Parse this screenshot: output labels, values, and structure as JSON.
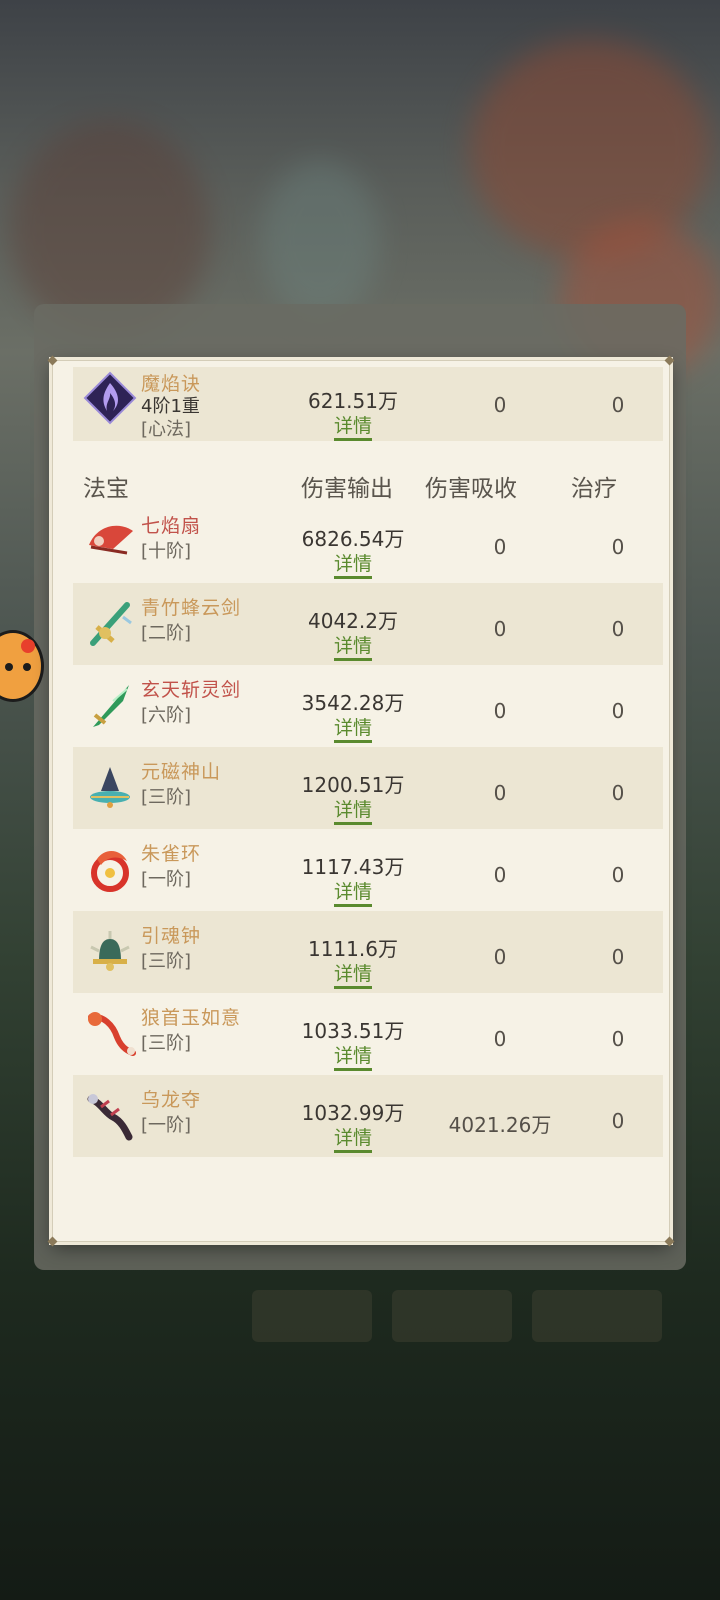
{
  "top_skill": {
    "name": "魔焰诀",
    "level": "4阶1重",
    "type": "[心法]",
    "damage": "621.51万",
    "detail": "详情",
    "absorb": "0",
    "heal": "0",
    "icon": "purple-flame-diamond-icon"
  },
  "header": {
    "col_item": "法宝",
    "col_damage": "伤害输出",
    "col_absorb": "伤害吸收",
    "col_heal": "治疗"
  },
  "items": [
    {
      "name": "七焰扇",
      "rank": "[十阶]",
      "damage": "6826.54万",
      "detail": "详情",
      "absorb": "0",
      "heal": "0",
      "color": "#c1524a",
      "icon": "fan-icon"
    },
    {
      "name": "青竹蜂云剑",
      "rank": "[二阶]",
      "damage": "4042.2万",
      "detail": "详情",
      "absorb": "0",
      "heal": "0",
      "color": "#c9985a",
      "icon": "bamboo-sword-icon"
    },
    {
      "name": "玄天斩灵剑",
      "rank": "[六阶]",
      "damage": "3542.28万",
      "detail": "详情",
      "absorb": "0",
      "heal": "0",
      "color": "#c1524a",
      "icon": "jade-sword-icon"
    },
    {
      "name": "元磁神山",
      "rank": "[三阶]",
      "damage": "1200.51万",
      "detail": "详情",
      "absorb": "0",
      "heal": "0",
      "color": "#c9985a",
      "icon": "mountain-icon"
    },
    {
      "name": "朱雀环",
      "rank": "[一阶]",
      "damage": "1117.43万",
      "detail": "详情",
      "absorb": "0",
      "heal": "0",
      "color": "#c9985a",
      "icon": "phoenix-ring-icon"
    },
    {
      "name": "引魂钟",
      "rank": "[三阶]",
      "damage": "1111.6万",
      "detail": "详情",
      "absorb": "0",
      "heal": "0",
      "color": "#c9985a",
      "icon": "bell-icon"
    },
    {
      "name": "狼首玉如意",
      "rank": "[三阶]",
      "damage": "1033.51万",
      "detail": "详情",
      "absorb": "0",
      "heal": "0",
      "color": "#c9985a",
      "icon": "scepter-icon"
    },
    {
      "name": "乌龙夺",
      "rank": "[一阶]",
      "damage": "1032.99万",
      "detail": "详情",
      "absorb": "4021.26万",
      "heal": "0",
      "color": "#c9985a",
      "icon": "dragon-icon"
    }
  ]
}
